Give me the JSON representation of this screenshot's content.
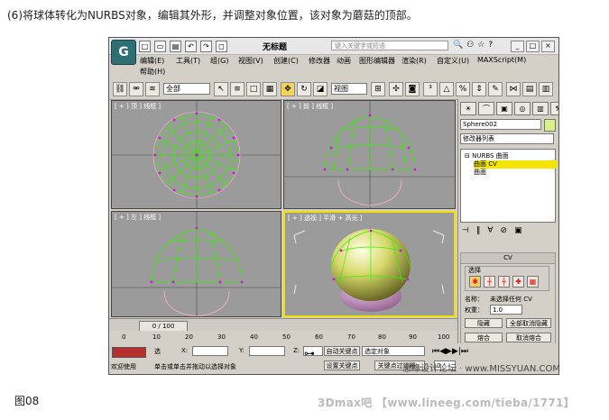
{
  "caption": "(6)将球体转化为NURBS对象，编辑其外形，并调整对象位置，该对象为蘑菇的顶部。",
  "figure_label": "图08",
  "footer_text": "3Dmax吧 【www.lineeg.com/tieba/1771】",
  "forum_watermark": "思缘设计论坛 · www.MISSYUAN.COM",
  "window": {
    "logo": "G",
    "title": "无标题",
    "search_placeholder": "键入关键字或短语",
    "quick_access": [
      "□",
      "▭",
      "▤",
      "↶",
      "↷",
      "◻"
    ],
    "title_icons": [
      "🔍",
      "⚇",
      "☆",
      "?"
    ],
    "controls": [
      "_",
      "□",
      "×"
    ]
  },
  "menus": [
    "编辑(E)",
    "工具(T)",
    "组(G)",
    "视图(V)",
    "创建(C)",
    "修改器",
    "动画",
    "图形编辑器",
    "渲染(R)",
    "自定义(U)",
    "MAXScript(M)",
    "帮助(H)"
  ],
  "toolbar": {
    "selection_filter": "全部",
    "coord_system": "视图"
  },
  "viewports": [
    {
      "label": "[ + ] 顶 ] 线框 ]"
    },
    {
      "label": "[ + ] 前 ] 线框 ]"
    },
    {
      "label": "[ + ] 左 ] 线框 ]"
    },
    {
      "label": "[ + ] 透视 ] 平滑 + 高光 ]"
    }
  ],
  "command_panel": {
    "tabs": [
      "☀",
      "⌒",
      "▣",
      "◎",
      "▥",
      "⚒"
    ],
    "object_name": "Sphere002",
    "modifier_list": "修改器列表",
    "stack": [
      "⊟ NURBS 曲面",
      "曲面 CV",
      "曲面"
    ],
    "stack_icons": [
      "⊣",
      "‖",
      "∀",
      "⊘",
      "▣"
    ],
    "rollout_title": "CV",
    "selection_group": "选择",
    "selection_buttons": [
      "✱",
      "┼",
      "┼",
      "✚",
      "▦"
    ],
    "name_label": "名称：",
    "name_value": "未选择任何 CV",
    "weight_label": "权重：",
    "weight_value": "1.0",
    "hide_button": "隐藏",
    "unhide_button": "全部取消隐藏",
    "fuse_button": "熔合",
    "unfuse_button": "取消熔合"
  },
  "timeline": {
    "slider": "0 / 100",
    "ticks": [
      "0",
      "10",
      "20",
      "30",
      "40",
      "50",
      "60",
      "70",
      "80",
      "90",
      "100"
    ]
  },
  "status": {
    "selected": "选",
    "x_label": "X:",
    "y_label": "Y:",
    "z_label": "Z:",
    "autokey": "自动关键点",
    "selected_object": "选定对象",
    "set_key": "设置关键点",
    "key_filters": "关键点过滤器...",
    "welcome": "欢迎使用",
    "prompt": "单击或单击并拖动以选择对象",
    "frame": "0"
  }
}
